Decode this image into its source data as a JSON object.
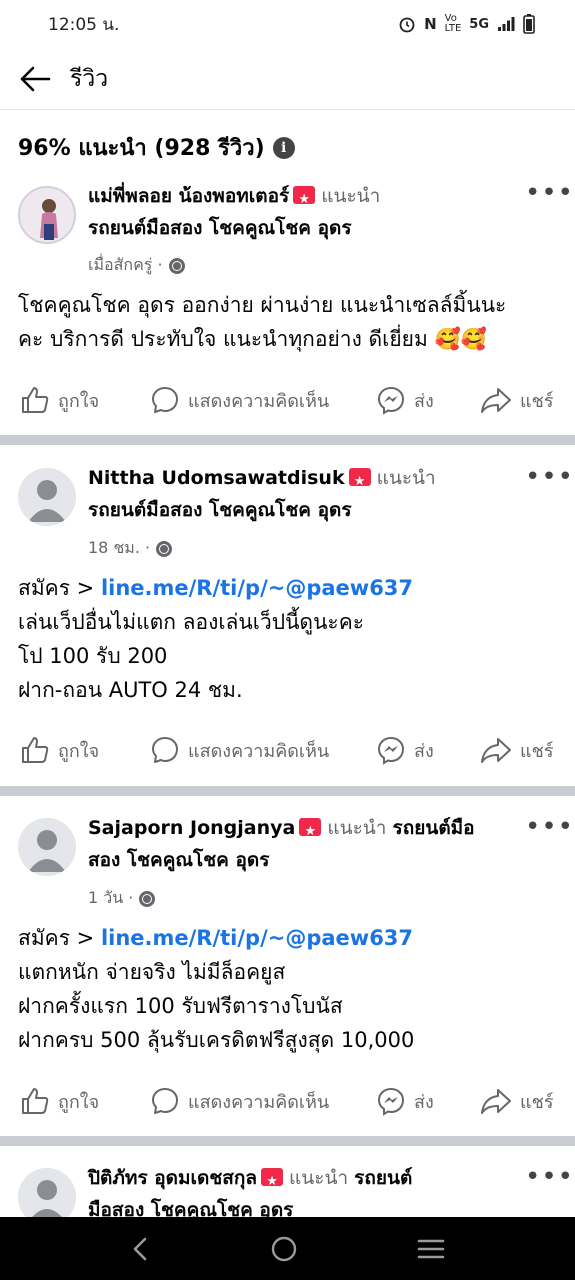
{
  "status_bar": {
    "time": "12:05 น.",
    "network": "5G"
  },
  "header": {
    "title": "รีวิว"
  },
  "summary": {
    "text": "96% แนะนำ (928 รีวิว)"
  },
  "actions": {
    "like": "ถูกใจ",
    "comment": "แสดงความคิดเห็น",
    "send": "ส่ง",
    "share": "แชร์"
  },
  "reviews": [
    {
      "name": "แม่พี่พลอย น้องพอทเตอร์",
      "recommends": "แนะนำ",
      "page": "รถยนต์มือสอง โชคคูณโชค อุดร",
      "time": "เมื่อสักครู่ ·",
      "lines": [
        "โชคคูณโชค อุดร ออกง่าย ผ่านง่าย แนะนำเซลล์มิ้นนะ",
        "คะ บริการดี ประทับใจ แนะนำทุกอย่าง ดีเยี่ยม 🥰🥰"
      ]
    },
    {
      "name": "Nittha Udomsawatdisuk",
      "recommends": "แนะนำ",
      "page": "รถยนต์มือสอง โชคคูณโชค อุดร",
      "time": "18 ชม. ·",
      "link_prefix": "สมัคร > ",
      "link": "line.me/R/ti/p/~@paew637",
      "lines": [
        "เล่นเว็ปอื่นไม่แตก ลองเล่นเว็ปนี้ดูนะคะ",
        "โป 100 รับ 200",
        "ฝาก-ถอน AUTO 24 ชม."
      ]
    },
    {
      "name": "Sajaporn Jongjanya",
      "recommends": "แนะนำ",
      "page_part1": "รถยนต์มือ",
      "page_part2": "สอง โชคคูณโชค อุดร",
      "time": "1 วัน ·",
      "link_prefix": "สมัคร > ",
      "link": "line.me/R/ti/p/~@paew637",
      "lines": [
        "แตกหนัก จ่ายจริง ไม่มีล็อคยูส",
        "ฝากครั้งแรก 100 รับฟรีตารางโบนัส",
        "ฝากครบ 500 ลุ้นรับเครดิตฟรีสูงสุด 10,000"
      ]
    },
    {
      "name": "ปิติภัทร อุดมเดชสกุล",
      "recommends": "แนะนำ",
      "page_part1": "รถยนต์",
      "page_part2": "มือสอง โชคคูณโชค อุดร"
    }
  ],
  "colors": {
    "link": "#1b74e4",
    "secondary_text": "#65676b",
    "divider": "#c9ccd1",
    "badge": "#f02849"
  },
  "icons": [
    "back-arrow-icon",
    "info-icon",
    "more-icon",
    "globe-icon",
    "like-icon",
    "comment-icon",
    "messenger-icon",
    "share-icon",
    "nav-back-icon",
    "nav-home-icon",
    "nav-recents-icon"
  ]
}
